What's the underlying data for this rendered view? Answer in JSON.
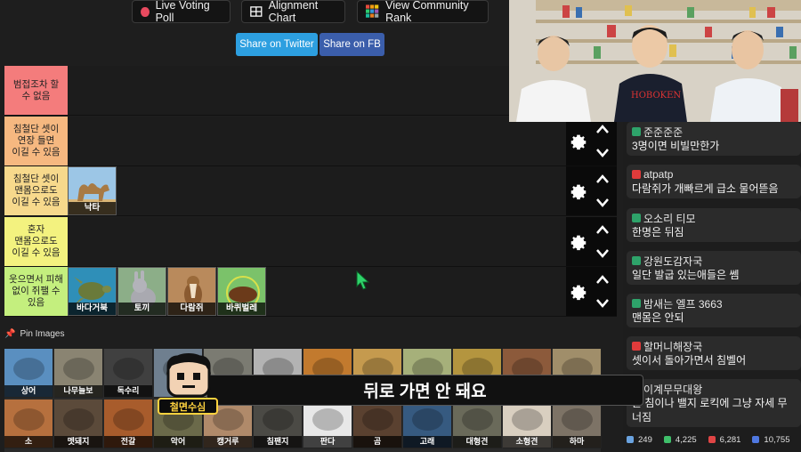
{
  "toolbar": {
    "live_voting_label": "Live Voting Poll",
    "alignment_chart_label": "Alignment Chart",
    "community_rank_label": "View Community Rank",
    "share_twitter_label": "Share on Twitter",
    "share_fb_label": "Share on FB",
    "colors": {
      "twitter": "#2d9fe0",
      "fb": "#3b5eab",
      "poll_dot": "#e84a5f"
    }
  },
  "tiers": [
    {
      "label": "범접조차 할 수 없음",
      "color": "#f47c7c",
      "items": []
    },
    {
      "label": "침철단 셋이 연장 들면 이길 수 있음",
      "color": "#f6b880",
      "items": []
    },
    {
      "label": "침철단 셋이 맨몸으로도 이길 수 있음",
      "color": "#f7d98c",
      "items": [
        {
          "name": "낙타",
          "icon": "camel"
        }
      ]
    },
    {
      "label": "혼자 맨몸으로도 이길 수 있음",
      "color": "#f3f27f",
      "items": []
    },
    {
      "label": "웃으면서 피해 없이 쥐팰 수 있음",
      "color": "#c4ef7e",
      "items": [
        {
          "name": "바다거북",
          "icon": "sea-turtle"
        },
        {
          "name": "토끼",
          "icon": "rabbit"
        },
        {
          "name": "다람쥐",
          "icon": "chipmunk"
        },
        {
          "name": "바퀴벌레",
          "icon": "cockroach"
        }
      ]
    }
  ],
  "pin_images_label": "Pin Images",
  "pool_row1": [
    {
      "name": "상어",
      "color": "#5a8fc0"
    },
    {
      "name": "나무늘보",
      "color": "#8a8472"
    },
    {
      "name": "독수리",
      "color": "#404040"
    },
    {
      "name": "",
      "color": "#6f7f8f"
    },
    {
      "name": "",
      "color": "#7b7b72"
    },
    {
      "name": "",
      "color": "#b3b3b3"
    },
    {
      "name": "",
      "color": "#c27a2e"
    },
    {
      "name": "",
      "color": "#c59a4e"
    },
    {
      "name": "",
      "color": "#a6b07a"
    },
    {
      "name": "",
      "color": "#b4953f"
    },
    {
      "name": "",
      "color": "#8c5a3b"
    },
    {
      "name": "",
      "color": "#a08e6a"
    }
  ],
  "pool_row2": [
    {
      "name": "소",
      "color": "#b6703e"
    },
    {
      "name": "멧돼지",
      "color": "#5b4a3a"
    },
    {
      "name": "전갈",
      "color": "#a85c2c"
    },
    {
      "name": "악어",
      "color": "#6b6a4a"
    },
    {
      "name": "캥거루",
      "color": "#b08a6a"
    },
    {
      "name": "침팬지",
      "color": "#4b4a45"
    },
    {
      "name": "판다",
      "color": "#e8e8e8"
    },
    {
      "name": "곰",
      "color": "#5a4130"
    },
    {
      "name": "고래",
      "color": "#365a80"
    },
    {
      "name": "대형견",
      "color": "#6a6a5a"
    },
    {
      "name": "소형견",
      "color": "#d9cfc0"
    },
    {
      "name": "하마",
      "color": "#7d7366"
    }
  ],
  "subtitle": "뒤로 가면 안 돼요",
  "mascot_name": "철면수심",
  "chat": [
    {
      "user": "준준준준",
      "text": "3명이면 비빌만한가",
      "badge": "member"
    },
    {
      "user": "atpatp",
      "text": "다람쥐가 개빠르게 급소 물어뜯음",
      "badge": "youtube"
    },
    {
      "user": "오소리 티모",
      "text": "한명은 뒤짐",
      "badge": "member"
    },
    {
      "user": "강원도감자국",
      "text": "일단 발굽 있는애들은 쎔",
      "badge": "member"
    },
    {
      "user": "밤새는 엘프 3663",
      "text": "맨몸은 안되",
      "badge": "member"
    },
    {
      "user": "할머니해장국",
      "text": "셋이서 돌아가면서 침벨어",
      "badge": "youtube"
    },
    {
      "user": "이계무무대왕",
      "text": "는 침이나 밸지 로킥에 그냥 자세 무너짐",
      "badge": "member"
    }
  ],
  "stats": {
    "viewers": "249",
    "likes": "4,225",
    "subs": "6,281",
    "total": "10,755"
  }
}
